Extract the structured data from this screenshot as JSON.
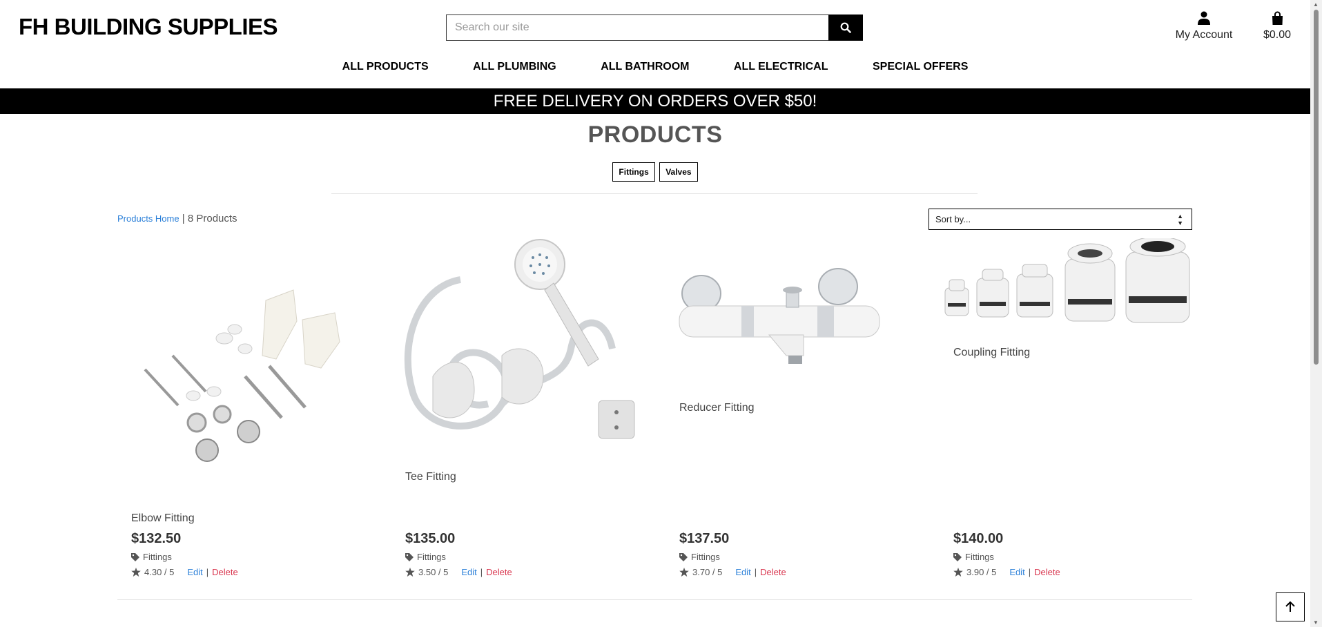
{
  "header": {
    "logo": "FH BUILDING SUPPLIES",
    "search_placeholder": "Search our site",
    "account_label": "My Account",
    "cart_total": "$0.00"
  },
  "nav": {
    "items": [
      "ALL PRODUCTS",
      "ALL PLUMBING",
      "ALL BATHROOM",
      "ALL ELECTRICAL",
      "SPECIAL OFFERS"
    ]
  },
  "banner": "FREE DELIVERY ON ORDERS OVER $50!",
  "page": {
    "title": "PRODUCTS",
    "categories": [
      "Fittings",
      "Valves"
    ],
    "breadcrumb_link": "Products Home",
    "breadcrumb_sep": "|",
    "product_count": "8 Products",
    "sort_label": "Sort by..."
  },
  "products": [
    {
      "name": "Elbow Fitting",
      "price": "$132.50",
      "category": "Fittings",
      "rating": "4.30 / 5",
      "edit": "Edit",
      "sep": "|",
      "delete": "Delete",
      "icon": "fixing-kit"
    },
    {
      "name": "Tee Fitting",
      "price": "$135.00",
      "category": "Fittings",
      "rating": "3.50 / 5",
      "edit": "Edit",
      "sep": "|",
      "delete": "Delete",
      "icon": "shower-hose"
    },
    {
      "name": "Reducer Fitting",
      "price": "$137.50",
      "category": "Fittings",
      "rating": "3.70 / 5",
      "edit": "Edit",
      "sep": "|",
      "delete": "Delete",
      "icon": "bath-mixer"
    },
    {
      "name": "Coupling Fitting",
      "price": "$140.00",
      "category": "Fittings",
      "rating": "3.90 / 5",
      "edit": "Edit",
      "sep": "|",
      "delete": "Delete",
      "icon": "cable-glands"
    }
  ],
  "colors": {
    "banner_bg": "#000000",
    "link": "#2a7fd8",
    "delete": "#d9344d"
  }
}
